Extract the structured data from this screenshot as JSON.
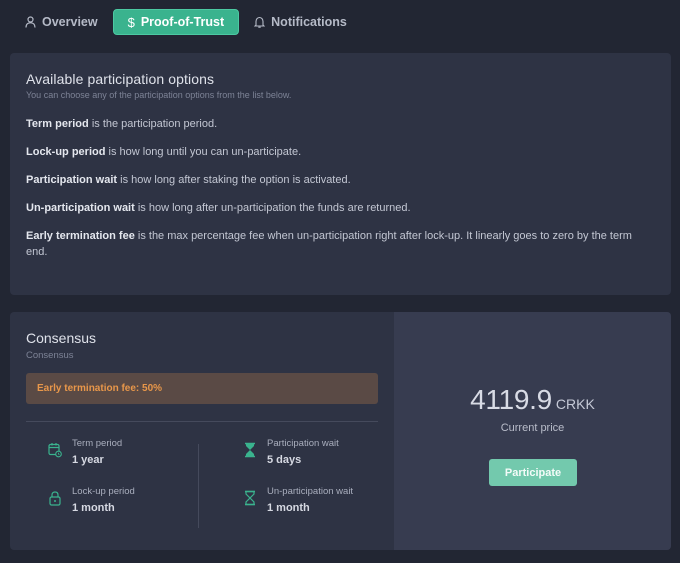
{
  "tabs": [
    {
      "label": "Overview",
      "icon": "user-icon",
      "active": false
    },
    {
      "label": "Proof-of-Trust",
      "icon": "dollar-icon",
      "active": true
    },
    {
      "label": "Notifications",
      "icon": "bell-icon",
      "active": false
    }
  ],
  "options_card": {
    "title": "Available participation options",
    "subtitle": "You can choose any of the participation options from the list below.",
    "definitions": [
      {
        "term": "Term period",
        "text": " is the participation period."
      },
      {
        "term": "Lock-up period",
        "text": " is how long until you can un-participate."
      },
      {
        "term": "Participation wait",
        "text": " is how long after staking the option is activated."
      },
      {
        "term": "Un-participation wait",
        "text": " is how long after un-participation the funds are returned."
      },
      {
        "term": "Early termination fee",
        "text": " is the max percentage fee when un-participation right after lock-up. It linearly goes to zero by the term end."
      }
    ]
  },
  "consensus": {
    "title": "Consensus",
    "subtitle": "Consensus",
    "fee_label": "Early termination fee: 50%",
    "term_period": {
      "label": "Term period",
      "value": "1 year",
      "icon": "calendar-clock-icon"
    },
    "lockup_period": {
      "label": "Lock-up period",
      "value": "1 month",
      "icon": "lock-icon"
    },
    "participation_wait": {
      "label": "Participation wait",
      "value": "5 days",
      "icon": "hourglass-filled-icon"
    },
    "unparticipation_wait": {
      "label": "Un-participation wait",
      "value": "1 month",
      "icon": "hourglass-icon"
    },
    "price": "4119.9",
    "currency": "CRKK",
    "price_label": "Current price",
    "button_label": "Participate"
  },
  "colors": {
    "background": "#222633",
    "card": "#2e3344",
    "accent": "#3ab38e",
    "button": "#73c9ad",
    "fee_text": "#e8974a"
  }
}
